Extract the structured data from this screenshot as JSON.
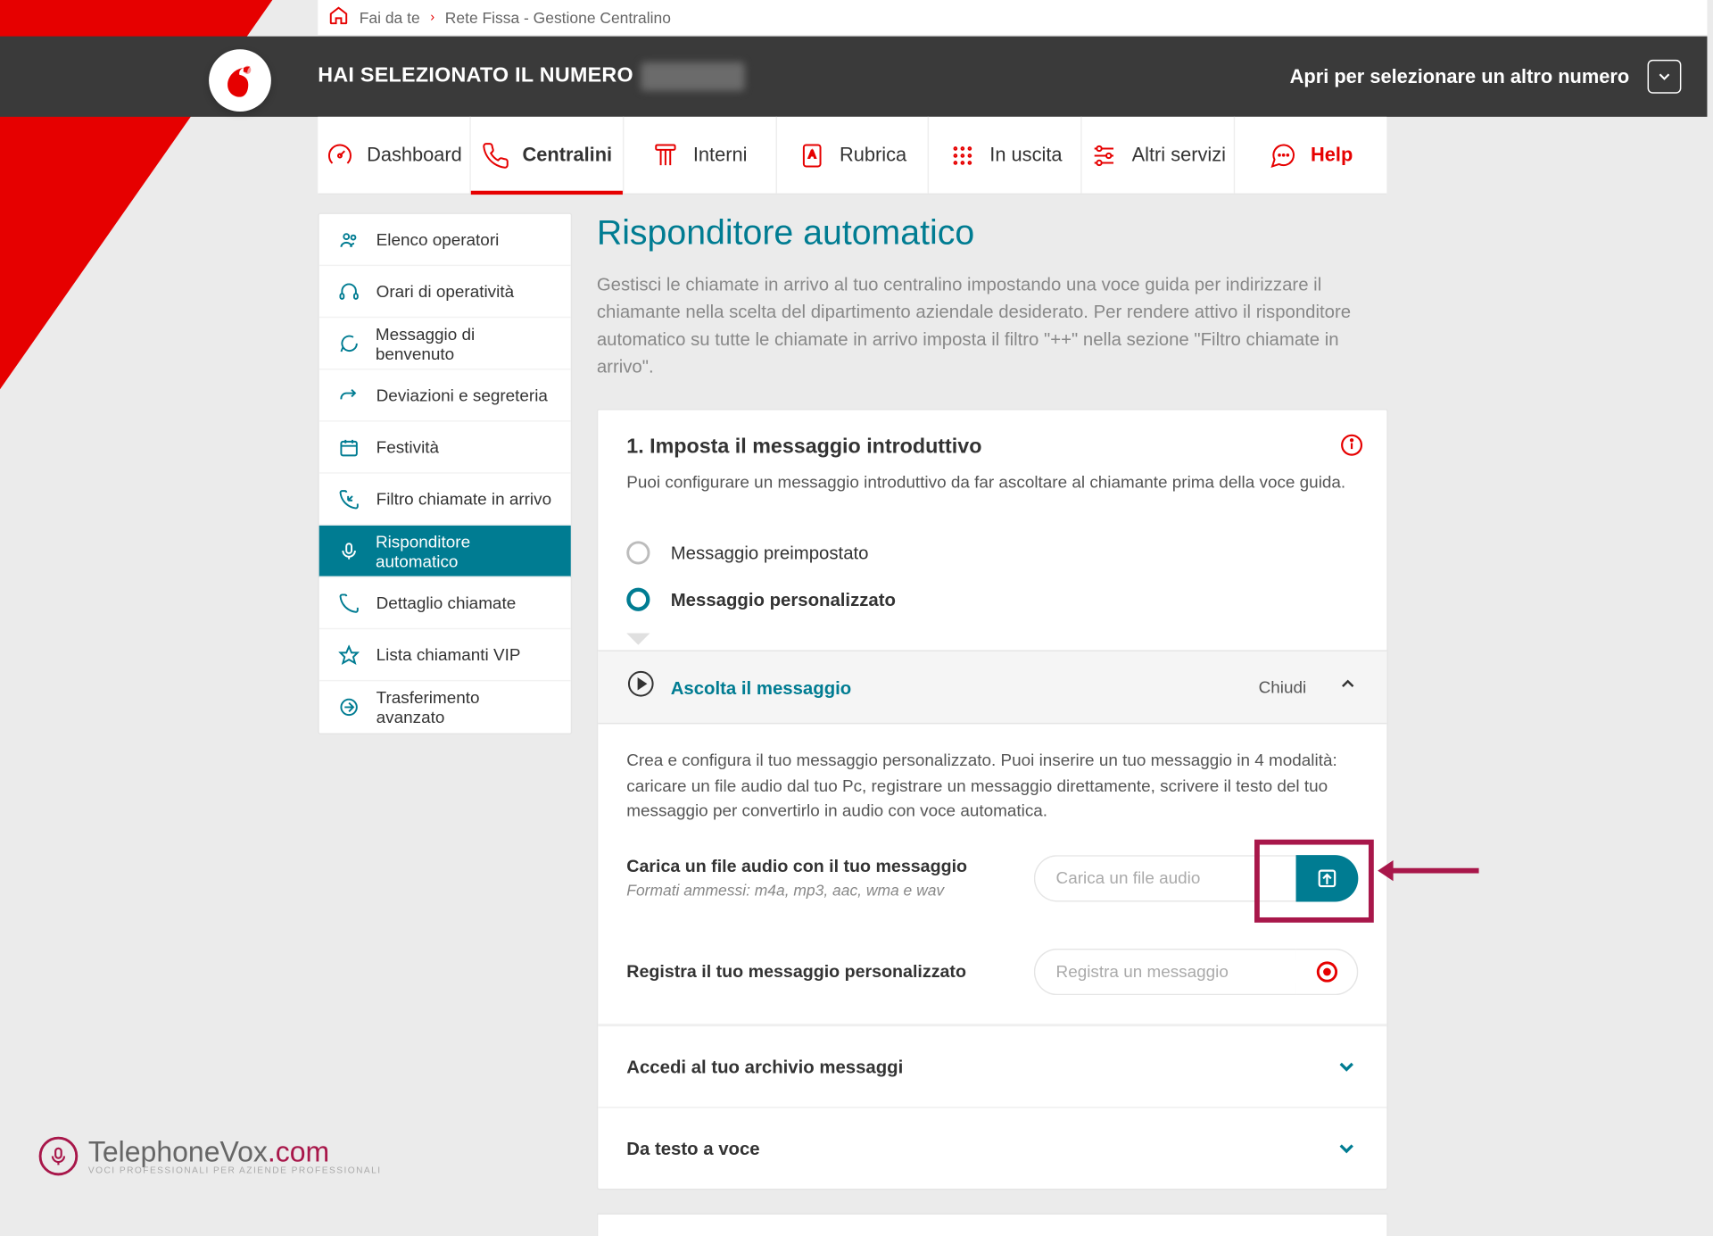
{
  "breadcrumb": {
    "home_label": "Fai da te",
    "page_label": "Rete Fissa - Gestione Centralino"
  },
  "header": {
    "prefix": "HAI SELEZIONATO IL NUMERO",
    "right_label": "Apri per selezionare un altro numero"
  },
  "nav": [
    {
      "label": "Dashboard"
    },
    {
      "label": "Centralini"
    },
    {
      "label": "Interni"
    },
    {
      "label": "Rubrica"
    },
    {
      "label": "In uscita"
    },
    {
      "label": "Altri servizi"
    },
    {
      "label": "Help"
    }
  ],
  "sidebar": [
    {
      "label": "Elenco operatori"
    },
    {
      "label": "Orari di operatività"
    },
    {
      "label": "Messaggio di benvenuto"
    },
    {
      "label": "Deviazioni e segreteria"
    },
    {
      "label": "Festività"
    },
    {
      "label": "Filtro chiamate in arrivo"
    },
    {
      "label": "Risponditore automatico"
    },
    {
      "label": "Dettaglio chiamate"
    },
    {
      "label": "Lista chiamanti VIP"
    },
    {
      "label": "Trasferimento avanzato"
    }
  ],
  "page": {
    "title": "Risponditore automatico",
    "desc": "Gestisci le chiamate in arrivo al tuo centralino impostando una voce guida per indirizzare il chiamante nella scelta del dipartimento aziendale desiderato. Per rendere attivo il risponditore automatico su tutte le chiamate in arrivo imposta il filtro \"++\" nella sezione \"Filtro chiamate in arrivo\"."
  },
  "step1": {
    "title": "1. Imposta il messaggio introduttivo",
    "subtitle": "Puoi configurare un messaggio introduttivo da far ascoltare al chiamante prima della voce guida.",
    "option_a": "Messaggio preimpostato",
    "option_b": "Messaggio personalizzato",
    "listen_label": "Ascolta il messaggio",
    "close_label": "Chiudi",
    "intro_text": "Crea e configura il tuo messaggio personalizzato. Puoi inserire un tuo messaggio in 4 modalità: caricare un file audio dal tuo Pc, registrare un messaggio direttamente, scrivere il testo del tuo messaggio per convertirlo in audio con voce automatica.",
    "upload_label": "Carica un file audio con il tuo messaggio",
    "upload_formats": "Formati ammessi: m4a, mp3, aac, wma e wav",
    "upload_placeholder": "Carica un file audio",
    "record_label": "Registra il tuo messaggio personalizzato",
    "record_placeholder": "Registra un messaggio",
    "archive_label": "Accedi al tuo archivio messaggi",
    "tts_label": "Da testo a voce"
  },
  "watermark": {
    "brand": "TelephoneVox",
    "suffix": ".com",
    "tagline": "VOCI PROFESSIONALI PER AZIENDE PROFESSIONALI"
  }
}
